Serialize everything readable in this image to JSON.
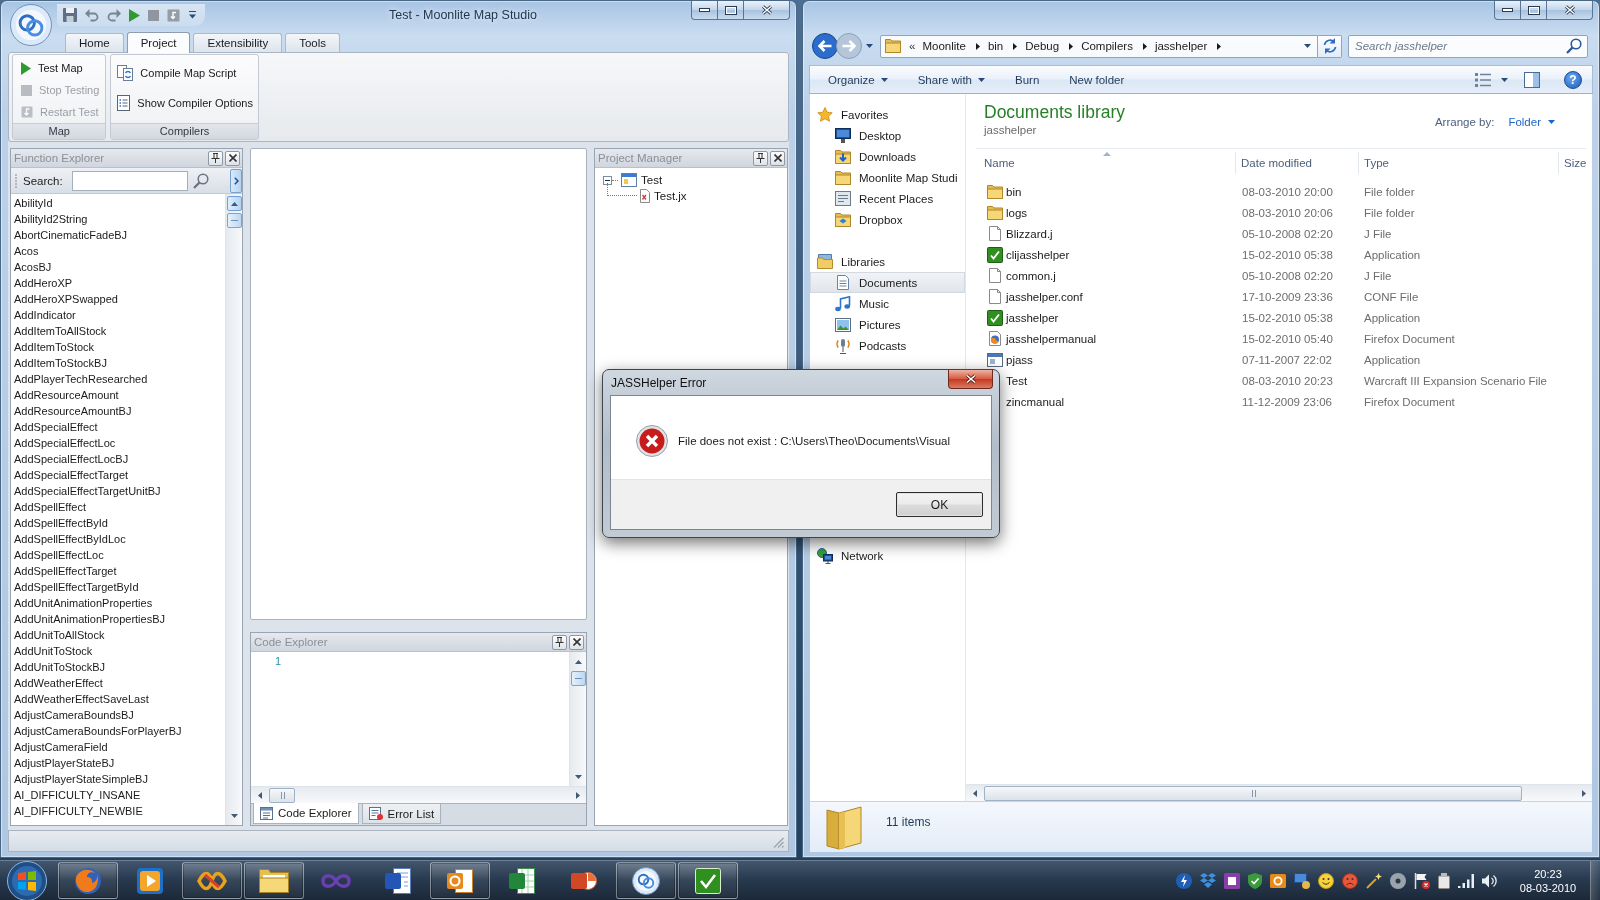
{
  "studio_window": {
    "title": "Test - Moonlite Map Studio",
    "ribbon_tabs": [
      {
        "label": "Home",
        "selected": false
      },
      {
        "label": "Project",
        "selected": true
      },
      {
        "label": "Extensibility",
        "selected": false
      },
      {
        "label": "Tools",
        "selected": false
      }
    ],
    "ribbon_groups": [
      {
        "label": "Map",
        "commands": [
          {
            "label": "Test Map",
            "disabled": false
          },
          {
            "label": "Stop Testing",
            "disabled": true
          },
          {
            "label": "Restart Test",
            "disabled": true
          }
        ]
      },
      {
        "label": "Compilers",
        "commands": [
          {
            "label": "Compile Map Script",
            "disabled": false
          },
          {
            "label": "Show Compiler Options",
            "disabled": false
          }
        ]
      }
    ],
    "function_explorer": {
      "title": "Function Explorer",
      "search_label": "Search:",
      "functions": [
        "AbilityId",
        "AbilityId2String",
        "AbortCinematicFadeBJ",
        "Acos",
        "AcosBJ",
        "AddHeroXP",
        "AddHeroXPSwapped",
        "AddIndicator",
        "AddItemToAllStock",
        "AddItemToStock",
        "AddItemToStockBJ",
        "AddPlayerTechResearched",
        "AddResourceAmount",
        "AddResourceAmountBJ",
        "AddSpecialEffect",
        "AddSpecialEffectLoc",
        "AddSpecialEffectLocBJ",
        "AddSpecialEffectTarget",
        "AddSpecialEffectTargetUnitBJ",
        "AddSpellEffect",
        "AddSpellEffectById",
        "AddSpellEffectByIdLoc",
        "AddSpellEffectLoc",
        "AddSpellEffectTarget",
        "AddSpellEffectTargetById",
        "AddUnitAnimationProperties",
        "AddUnitAnimationPropertiesBJ",
        "AddUnitToAllStock",
        "AddUnitToStock",
        "AddUnitToStockBJ",
        "AddWeatherEffect",
        "AddWeatherEffectSaveLast",
        "AdjustCameraBoundsBJ",
        "AdjustCameraBoundsForPlayerBJ",
        "AdjustCameraField",
        "AdjustPlayerStateBJ",
        "AdjustPlayerStateSimpleBJ",
        "AI_DIFFICULTY_INSANE",
        "AI_DIFFICULTY_NEWBIE"
      ]
    },
    "code_explorer": {
      "title": "Code Explorer",
      "line_numbers": [
        "1"
      ]
    },
    "dock_tabs": [
      {
        "label": "Code Explorer",
        "selected": true
      },
      {
        "label": "Error List",
        "selected": false
      }
    ],
    "project_manager": {
      "title": "Project Manager",
      "tree": [
        {
          "label": "Test",
          "expanded": true,
          "children": [
            {
              "label": "Test.jx"
            }
          ]
        }
      ]
    }
  },
  "explorer_window": {
    "address_bar": {
      "overflow": "«",
      "breadcrumb": [
        "Moonlite",
        "bin",
        "Debug",
        "Compilers",
        "jasshelper"
      ]
    },
    "search": {
      "placeholder": "Search jasshelper"
    },
    "toolbar": [
      {
        "label": "Organize",
        "dropdown": true
      },
      {
        "label": "Share with",
        "dropdown": true
      },
      {
        "label": "Burn",
        "dropdown": false
      },
      {
        "label": "New folder",
        "dropdown": false
      }
    ],
    "help_button": "?",
    "navigation": [
      {
        "label": "Favorites",
        "selected": false,
        "children": [
          {
            "label": "Desktop",
            "selected": false
          },
          {
            "label": "Downloads",
            "selected": false
          },
          {
            "label": "Moonlite Map Studi",
            "selected": false
          },
          {
            "label": "Recent Places",
            "selected": false
          },
          {
            "label": "Dropbox",
            "selected": false
          }
        ]
      },
      {
        "label": "Libraries",
        "selected": false,
        "children": [
          {
            "label": "Documents",
            "selected": true
          },
          {
            "label": "Music",
            "selected": false
          },
          {
            "label": "Pictures",
            "selected": false
          },
          {
            "label": "Podcasts",
            "selected": false
          }
        ]
      },
      {
        "label": "Network",
        "selected": false
      }
    ],
    "library": {
      "title": "Documents library",
      "subtitle": "jasshelper",
      "arrange_label": "Arrange by:",
      "arrange_value": "Folder"
    },
    "columns": [
      {
        "label": "Name",
        "sorted": true
      },
      {
        "label": "Date modified",
        "sorted": false
      },
      {
        "label": "Type",
        "sorted": false
      },
      {
        "label": "Size",
        "sorted": false
      }
    ],
    "files": [
      {
        "name": "bin",
        "date": "08-03-2010 20:00",
        "type": "File folder"
      },
      {
        "name": "logs",
        "date": "08-03-2010 20:06",
        "type": "File folder"
      },
      {
        "name": "Blizzard.j",
        "date": "05-10-2008 02:20",
        "type": "J File"
      },
      {
        "name": "clijasshelper",
        "date": "15-02-2010 05:38",
        "type": "Application"
      },
      {
        "name": "common.j",
        "date": "05-10-2008 02:20",
        "type": "J File"
      },
      {
        "name": "jasshelper.conf",
        "date": "17-10-2009 23:36",
        "type": "CONF File"
      },
      {
        "name": "jasshelper",
        "date": "15-02-2010 05:38",
        "type": "Application"
      },
      {
        "name": "jasshelpermanual",
        "date": "15-02-2010 05:40",
        "type": "Firefox Document"
      },
      {
        "name": "pjass",
        "date": "07-11-2007 22:02",
        "type": "Application"
      },
      {
        "name": "Test",
        "date": "08-03-2010 20:23",
        "type": "Warcraft III Expansion Scenario File"
      },
      {
        "name": "zincmanual",
        "date": "11-12-2009 23:06",
        "type": "Firefox Document"
      }
    ],
    "details": "11 items"
  },
  "dialog": {
    "title": "JASSHelper Error",
    "message": "File does not exist : C:\\Users\\Theo\\Documents\\Visual",
    "button": "OK"
  },
  "taskbar": {
    "buttons": [
      {
        "running": true
      },
      {
        "running": false
      },
      {
        "running": true
      },
      {
        "running": true
      },
      {
        "running": false
      },
      {
        "running": false
      },
      {
        "running": true
      },
      {
        "running": false
      },
      {
        "running": false
      },
      {
        "running": true
      },
      {
        "running": true
      }
    ],
    "clock_time": "20:23",
    "clock_date": "08-03-2010"
  }
}
